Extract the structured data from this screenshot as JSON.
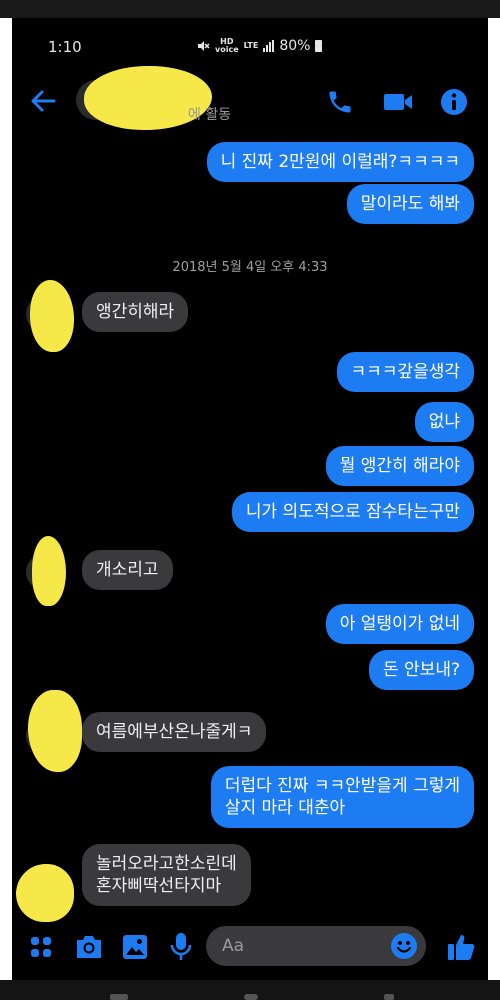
{
  "status": {
    "time": "1:10",
    "network": "LTE",
    "battery": "80%"
  },
  "header": {
    "active_text": "에 활동"
  },
  "messages": [
    {
      "from": "me",
      "text": "니 진짜 2만원에 이럴래?ㅋㅋㅋㅋ"
    },
    {
      "from": "me",
      "text": "말이라도 해봐"
    },
    {
      "type": "date",
      "text": "2018년 5월 4일 오후 4:33"
    },
    {
      "from": "other",
      "text": "앵간히해라"
    },
    {
      "from": "me",
      "text": "ㅋㅋㅋ갚을생각"
    },
    {
      "from": "me",
      "text": "없냐"
    },
    {
      "from": "me",
      "text": "뭘 앵간히 해라야"
    },
    {
      "from": "me",
      "text": "니가 의도적으로 잠수타는구만"
    },
    {
      "from": "other",
      "text": "개소리고"
    },
    {
      "from": "me",
      "text": "아 얼탱이가 없네"
    },
    {
      "from": "me",
      "text": "돈 안보내?"
    },
    {
      "from": "other",
      "text": "여름에부산온나줄게ㅋ"
    },
    {
      "from": "me",
      "text": "더럽다 진짜 ㅋㅋ안받을게 그렇게\n살지 마라 대춘아"
    },
    {
      "from": "other",
      "text": "놀러오라고한소린데\n혼자삐딱선타지마"
    }
  ],
  "composer": {
    "placeholder": "Aa"
  },
  "colors": {
    "sent": "#1e7cf2",
    "received": "#3a3a3c",
    "accent": "#1e7cf2",
    "redaction": "#f7e84a"
  }
}
